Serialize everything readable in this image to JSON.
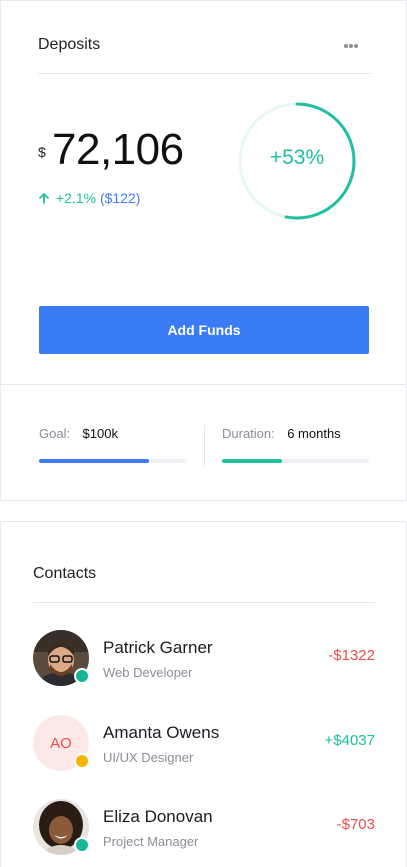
{
  "deposits": {
    "title": "Deposits",
    "currency": "$",
    "amount": "72,106",
    "change_pct": "+2.1%",
    "change_amount": "($122)",
    "ring_label": "+53%",
    "ring_progress": 0.53,
    "add_funds_label": "Add Funds",
    "goal": {
      "label": "Goal:",
      "value": "$100k",
      "progress": 0.75
    },
    "duration": {
      "label": "Duration:",
      "value": "6 months",
      "progress": 0.41
    },
    "colors": {
      "accent": "#3b7cf6",
      "positive": "#1fbf9f",
      "negative": "#ea4d4d"
    }
  },
  "contacts": {
    "title": "Contacts",
    "items": [
      {
        "name": "Patrick Garner",
        "role": "Web Developer",
        "amount": "-$1322",
        "avatar": "photo",
        "status": "online"
      },
      {
        "name": "Amanta Owens",
        "role": "UI/UX Designer",
        "amount": "+$4037",
        "avatar_initials": "AO",
        "status": "away"
      },
      {
        "name": "Eliza Donovan",
        "role": "Project Manager",
        "amount": "-$703",
        "avatar": "photo",
        "status": "online"
      }
    ]
  }
}
